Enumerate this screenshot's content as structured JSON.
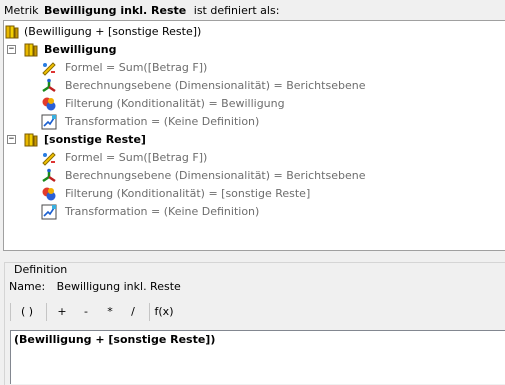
{
  "header": {
    "prefix": "Metrik",
    "metric_name": "Bewilligung inkl. Reste",
    "suffix": "ist definiert als:"
  },
  "tree": {
    "root": {
      "label": "(Bewilligung + [sonstige Reste])",
      "icon": "metric-icon"
    },
    "groups": [
      {
        "label": "Bewilligung",
        "toggle": "−",
        "icon": "metric-icon",
        "children": [
          {
            "label": "Formel = Sum([Betrag F])",
            "icon": "formula-icon"
          },
          {
            "label": "Berechnungsebene (Dimensionalität) = Berichtsebene",
            "icon": "dimensionality-icon"
          },
          {
            "label": "Filterung (Konditionalität) = Bewilligung",
            "icon": "filter-icon"
          },
          {
            "label": "Transformation = (Keine Definition)",
            "icon": "transformation-icon"
          }
        ]
      },
      {
        "label": "[sonstige Reste]",
        "toggle": "−",
        "icon": "metric-icon",
        "children": [
          {
            "label": "Formel = Sum([Betrag F])",
            "icon": "formula-icon"
          },
          {
            "label": "Berechnungsebene (Dimensionalität) = Berichtsebene",
            "icon": "dimensionality-icon"
          },
          {
            "label": "Filterung (Konditionalität) = [sonstige Reste]",
            "icon": "filter-icon"
          },
          {
            "label": "Transformation = (Keine Definition)",
            "icon": "transformation-icon"
          }
        ]
      }
    ]
  },
  "definition": {
    "group_title": "Definition",
    "name_label": "Name:",
    "name_value": "Bewilligung inkl. Reste",
    "toolbar": {
      "parens": "( )",
      "plus": "+",
      "minus": "-",
      "multiply": "*",
      "divide": "/",
      "function": "f(x)"
    },
    "formula": "(Bewilligung + [sonstige Reste])"
  }
}
